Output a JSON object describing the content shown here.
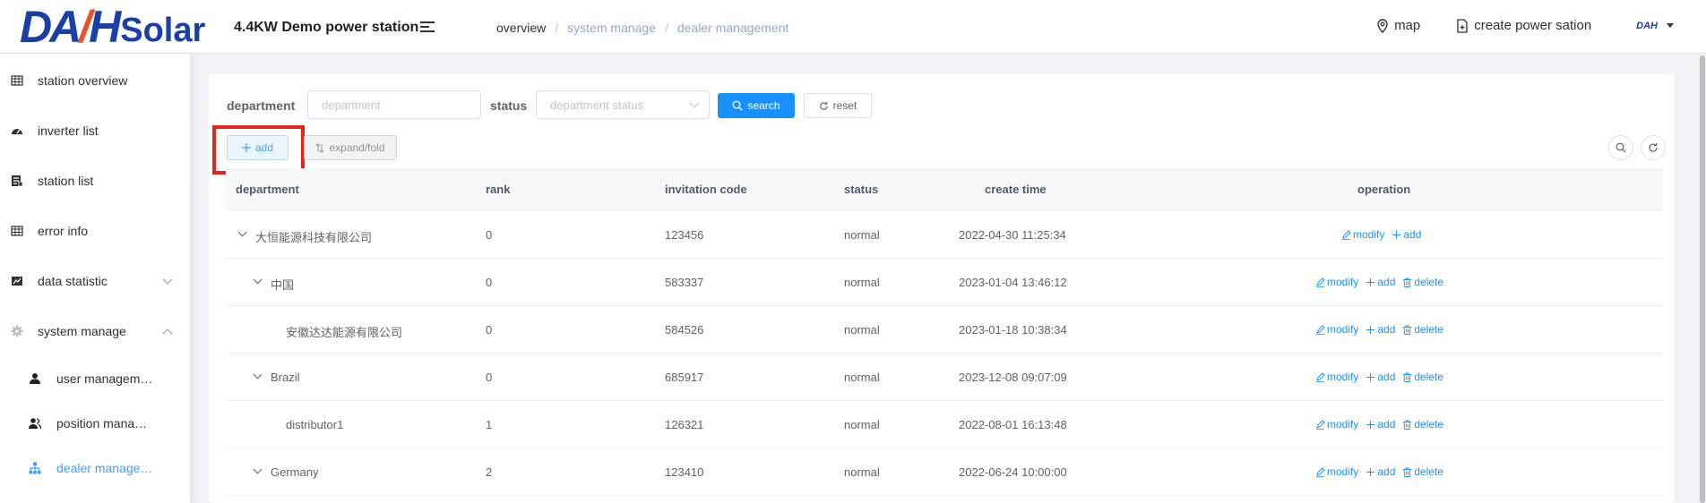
{
  "header": {
    "logo_text": "DAH",
    "logo_solar": "Solar",
    "station_title": "4.4KW Demo power station",
    "breadcrumb": [
      "overview",
      "system manage",
      "dealer management"
    ],
    "breadcrumb_sep": "/",
    "map_label": "map",
    "create_label": "create power sation",
    "avatar_text": "DAH"
  },
  "sidebar": {
    "items": [
      {
        "label": "station overview",
        "icon": "table-icon"
      },
      {
        "label": "inverter list",
        "icon": "dashboard-icon"
      },
      {
        "label": "station list",
        "icon": "list-icon"
      },
      {
        "label": "error info",
        "icon": "table-icon"
      },
      {
        "label": "data statistic",
        "icon": "chart-icon"
      },
      {
        "label": "system manage",
        "icon": "gear-icon"
      }
    ],
    "sub_items": [
      {
        "label": "user managem…",
        "icon": "user-icon"
      },
      {
        "label": "position mana…",
        "icon": "users-icon"
      },
      {
        "label": "dealer manage…",
        "icon": "tree-icon"
      }
    ]
  },
  "filters": {
    "department_label": "department",
    "department_placeholder": "department",
    "status_label": "status",
    "status_placeholder": "department status",
    "search_label": "search",
    "reset_label": "reset"
  },
  "toolbar": {
    "add_label": "add",
    "expand_label": "expand/fold"
  },
  "table": {
    "columns": [
      "department",
      "rank",
      "invitation code",
      "status",
      "create time",
      "operation"
    ],
    "rows": [
      {
        "department": "大恒能源科技有限公司",
        "rank": "0",
        "code": "123456",
        "status": "normal",
        "time": "2022-04-30 11:25:34",
        "level": 0,
        "expand": true,
        "ops": [
          "modify",
          "add"
        ]
      },
      {
        "department": "中国",
        "rank": "0",
        "code": "583337",
        "status": "normal",
        "time": "2023-01-04 13:46:12",
        "level": 1,
        "expand": true,
        "ops": [
          "modify",
          "add",
          "delete"
        ]
      },
      {
        "department": "安徽达达能源有限公司",
        "rank": "0",
        "code": "584526",
        "status": "normal",
        "time": "2023-01-18 10:38:34",
        "level": 2,
        "expand": false,
        "ops": [
          "modify",
          "add",
          "delete"
        ]
      },
      {
        "department": "Brazil",
        "rank": "0",
        "code": "685917",
        "status": "normal",
        "time": "2023-12-08 09:07:09",
        "level": 1,
        "expand": true,
        "ops": [
          "modify",
          "add",
          "delete"
        ]
      },
      {
        "department": "distributor1",
        "rank": "1",
        "code": "126321",
        "status": "normal",
        "time": "2022-08-01 16:13:48",
        "level": 2,
        "expand": false,
        "ops": [
          "modify",
          "add",
          "delete"
        ]
      },
      {
        "department": "Germany",
        "rank": "2",
        "code": "123410",
        "status": "normal",
        "time": "2022-06-24 10:00:00",
        "level": 1,
        "expand": true,
        "ops": [
          "modify",
          "add",
          "delete"
        ]
      }
    ]
  },
  "colors": {
    "primary": "#1890ff",
    "highlight": "#e8231a",
    "brand_blue": "#1a3fa8",
    "brand_orange": "#e8512c"
  }
}
